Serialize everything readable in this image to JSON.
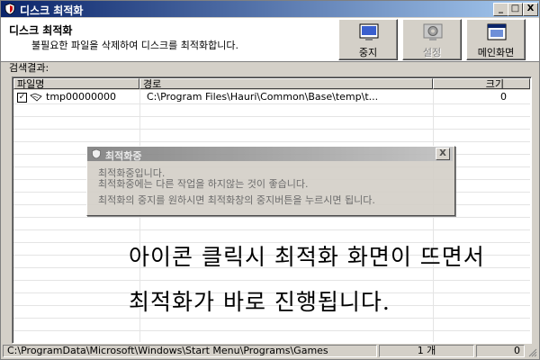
{
  "window": {
    "title": "디스크 최적화",
    "controls": {
      "minimize": "_",
      "maximize": "□",
      "close": "X"
    }
  },
  "header": {
    "title": "디스크 최적화",
    "description": "불필요한 파일을 삭제하여 디스크를 최적화합니다.",
    "buttons": [
      {
        "label": "중지",
        "icon": "stop-monitor-icon",
        "enabled": true
      },
      {
        "label": "설정",
        "icon": "settings-gear-icon",
        "enabled": false
      },
      {
        "label": "메인화면",
        "icon": "main-screen-window-icon",
        "enabled": true
      }
    ]
  },
  "results": {
    "label": "검색결과:",
    "columns": [
      "파일명",
      "경로",
      "크기"
    ],
    "rows": [
      {
        "checked": true,
        "name": "tmp00000000",
        "path": "C:\\Program Files\\Hauri\\Common\\Base\\temp\\t...",
        "size": "0"
      }
    ]
  },
  "dialog": {
    "title": "최적화중",
    "line1": "최적화중입니다.",
    "line2": "최적화중에는 다른 작업을 하지않는 것이 좋습니다.",
    "line3": "최적화의 중지를 원하시면 최적화창의 중지버튼을 누르시면 됩니다.",
    "close": "X"
  },
  "annotation": {
    "line1": "아이콘 클릭시 최적화 화면이 뜨면서",
    "line2": "최적화가 바로 진행됩니다."
  },
  "statusbar": {
    "path": "C:\\ProgramData\\Microsoft\\Windows\\Start Menu\\Programs\\Games",
    "count": "1 개",
    "size": "0"
  },
  "colors": {
    "title_active": "#0a246a",
    "face": "#d4d0c8"
  }
}
